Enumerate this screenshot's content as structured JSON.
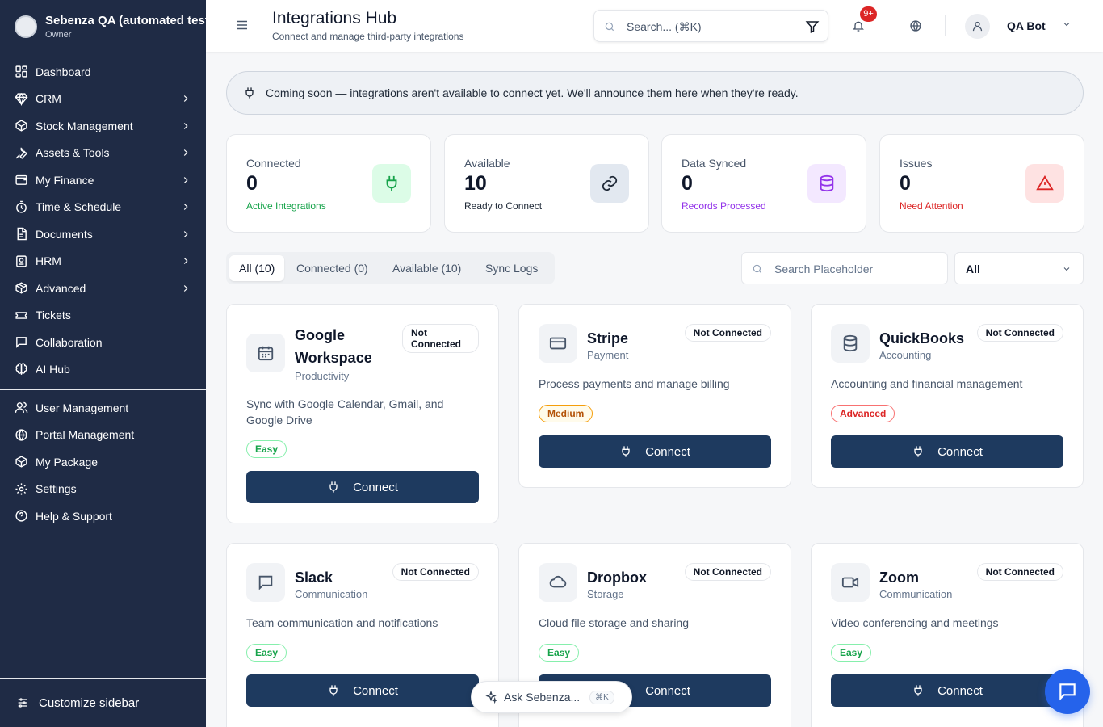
{
  "workspace": {
    "name": "Sebenza QA (automated tests)",
    "role": "Owner"
  },
  "sidebar": {
    "items": [
      {
        "label": "Dashboard",
        "icon": "dashboard-icon",
        "has_children": false
      },
      {
        "label": "CRM",
        "icon": "diamond-icon",
        "has_children": true
      },
      {
        "label": "Stock Management",
        "icon": "box-icon",
        "has_children": true
      },
      {
        "label": "Assets & Tools",
        "icon": "wrench-icon",
        "has_children": true
      },
      {
        "label": "My Finance",
        "icon": "wallet-icon",
        "has_children": true
      },
      {
        "label": "Time & Schedule",
        "icon": "timer-icon",
        "has_children": true
      },
      {
        "label": "Documents",
        "icon": "document-icon",
        "has_children": true
      },
      {
        "label": "HRM",
        "icon": "id-card-icon",
        "has_children": true
      },
      {
        "label": "Advanced",
        "icon": "package-icon",
        "has_children": true
      },
      {
        "label": "Tickets",
        "icon": "ticket-icon",
        "has_children": false
      },
      {
        "label": "Collaboration",
        "icon": "chat-icon",
        "has_children": false
      },
      {
        "label": "AI Hub",
        "icon": "brain-icon",
        "has_children": false
      }
    ],
    "bottom_items": [
      {
        "label": "User Management",
        "icon": "users-icon"
      },
      {
        "label": "Portal Management",
        "icon": "globe-icon"
      },
      {
        "label": "My Package",
        "icon": "package-icon"
      },
      {
        "label": "Settings",
        "icon": "gear-icon"
      },
      {
        "label": "Help & Support",
        "icon": "help-icon"
      }
    ],
    "customize_label": "Customize sidebar"
  },
  "header": {
    "title": "Integrations Hub",
    "subtitle": "Connect and manage third-party integrations",
    "search_placeholder": "Search... (⌘K)",
    "notification_badge": "9+",
    "user_name": "QA Bot"
  },
  "banner": {
    "text": "Coming soon — integrations aren't available to connect yet. We'll announce them here when they're ready."
  },
  "stats": [
    {
      "label": "Connected",
      "value": "0",
      "sub": "Active Integrations",
      "color": "#16a34a",
      "bg": "#dcfce7",
      "icon": "plug-icon"
    },
    {
      "label": "Available",
      "value": "10",
      "sub": "Ready to Connect",
      "color": "#1f2937",
      "bg": "#e2e8f0",
      "icon": "link-icon"
    },
    {
      "label": "Data Synced",
      "value": "0",
      "sub": "Records Processed",
      "color": "#9333ea",
      "bg": "#f3e8ff",
      "icon": "database-icon"
    },
    {
      "label": "Issues",
      "value": "0",
      "sub": "Need Attention",
      "color": "#dc2626",
      "bg": "#fee2e2",
      "icon": "alert-icon"
    }
  ],
  "tabs": [
    "All (10)",
    "Connected (0)",
    "Available (10)",
    "Sync Logs"
  ],
  "list_search_placeholder": "Search Placeholder",
  "filter_value": "All",
  "cards": [
    {
      "name": "Google Workspace",
      "category": "Productivity",
      "status": "Not Connected",
      "description": "Sync with Google Calendar, Gmail, and Google Drive",
      "difficulty": "Easy",
      "button": "Connect",
      "icon": "calendar-icon"
    },
    {
      "name": "Stripe",
      "category": "Payment",
      "status": "Not Connected",
      "description": "Process payments and manage billing",
      "difficulty": "Medium",
      "button": "Connect",
      "icon": "credit-card-icon"
    },
    {
      "name": "QuickBooks",
      "category": "Accounting",
      "status": "Not Connected",
      "description": "Accounting and financial management",
      "difficulty": "Advanced",
      "button": "Connect",
      "icon": "database-icon"
    },
    {
      "name": "Slack",
      "category": "Communication",
      "status": "Not Connected",
      "description": "Team communication and notifications",
      "difficulty": "Easy",
      "button": "Connect",
      "icon": "message-icon"
    },
    {
      "name": "Dropbox",
      "category": "Storage",
      "status": "Not Connected",
      "description": "Cloud file storage and sharing",
      "difficulty": "Easy",
      "button": "Connect",
      "icon": "cloud-icon"
    },
    {
      "name": "Zoom",
      "category": "Communication",
      "status": "Not Connected",
      "description": "Video conferencing and meetings",
      "difficulty": "Easy",
      "button": "Connect",
      "icon": "video-icon"
    }
  ],
  "ask": {
    "label": "Ask Sebenza...",
    "shortcut": "⌘K"
  }
}
